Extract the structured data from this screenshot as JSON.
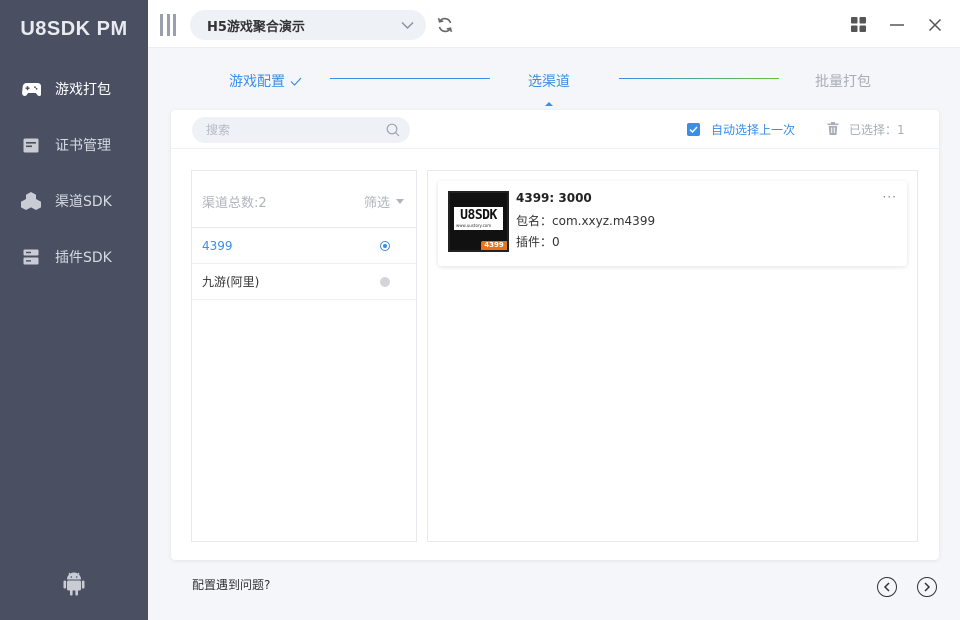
{
  "app": {
    "brand": "U8SDK PM"
  },
  "sidebar": {
    "items": [
      {
        "label": "游戏打包",
        "icon": "gamepad-icon",
        "active": true
      },
      {
        "label": "证书管理",
        "icon": "certificate-icon",
        "active": false
      },
      {
        "label": "渠道SDK",
        "icon": "cubes-icon",
        "active": false
      },
      {
        "label": "插件SDK",
        "icon": "plugin-icon",
        "active": false
      }
    ],
    "bottom_icon": "android-icon"
  },
  "topbar": {
    "project": "H5游戏聚合演示",
    "icons": [
      "menu-toggle-icon",
      "chevron-down-icon",
      "refresh-icon",
      "grid-icon",
      "minimize-icon",
      "close-icon"
    ]
  },
  "steps": [
    {
      "label": "游戏配置",
      "state": "done"
    },
    {
      "label": "选渠道",
      "state": "current"
    },
    {
      "label": "批量打包",
      "state": "pending"
    }
  ],
  "toolbar": {
    "search_placeholder": "搜索",
    "auto_select_label": "自动选择上一次",
    "auto_select_checked": true,
    "selected_count_label": "已选择：1"
  },
  "channel_list": {
    "total_label": "渠道总数:2",
    "filter_label": "筛选",
    "items": [
      {
        "name": "4399",
        "selected": true
      },
      {
        "name": "九游(阿里)",
        "selected": false
      }
    ]
  },
  "channel_detail": {
    "title": "4399: 3000",
    "package_label": "包名：com.xxyz.m4399",
    "plugin_label": "插件：0",
    "logo_text": "U8SDK",
    "logo_url": "www.uustory.com",
    "logo_badge": "4399",
    "more_label": "···"
  },
  "footer": {
    "help_label": "配置遇到问题?"
  },
  "colors": {
    "sidebar_bg": "#4a4f62",
    "accent": "#3a8ee6",
    "step_line_done": "#3a8ee6",
    "step_line_next": "#67c23a",
    "muted_text": "#a8adb7"
  }
}
